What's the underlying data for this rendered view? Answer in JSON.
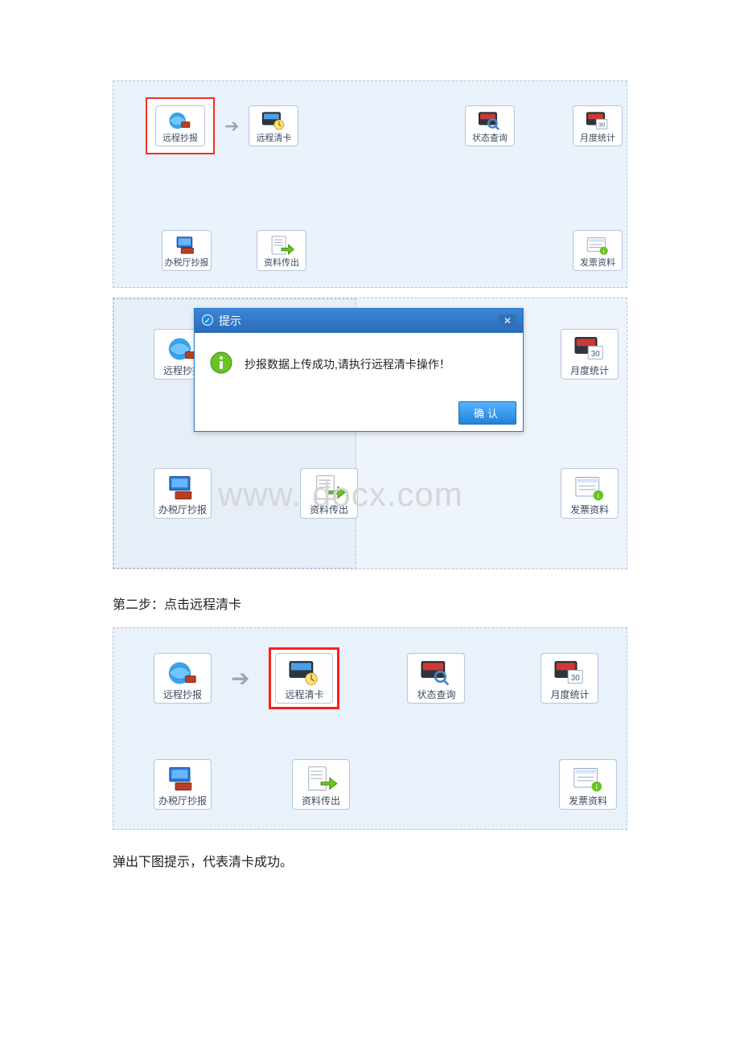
{
  "icons": {
    "remote_report": "远程抄报",
    "remote_clear": "远程清卡",
    "status_query": "状态查询",
    "monthly_stats": "月度统计",
    "hall_report": "办税厅抄报",
    "export_data": "资料传出",
    "invoice_data": "发票资料"
  },
  "dialog": {
    "title": "提示",
    "message": "抄报数据上传成功,请执行远程清卡操作！",
    "confirm": "确认"
  },
  "text": {
    "step2": "第二步：点击远程清卡",
    "success_hint": "弹出下图提示，代表清卡成功。"
  },
  "watermark": "www.       docx.com"
}
